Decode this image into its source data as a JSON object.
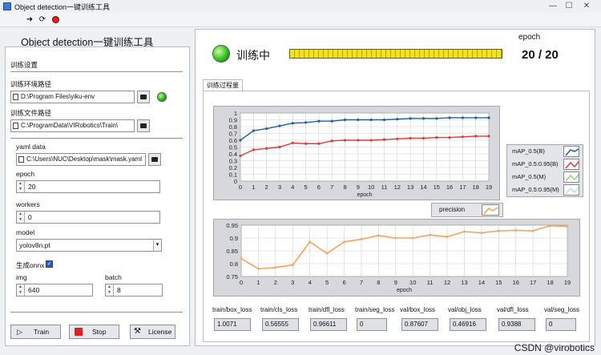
{
  "window": {
    "title": "Object detection一键训练工具"
  },
  "left": {
    "app_title": "Object detection一键训练工具",
    "section_title": "训练设置",
    "env_label": "训练环境路径",
    "env_value": "D:\\Program Files\\yiku-env",
    "files_label": "训练文件路径",
    "files_value": "C:\\ProgramData\\VIRobotics\\Train\\",
    "yaml_label": "yaml data",
    "yaml_value": "C:\\Users\\NUC\\Desktop\\mask\\mask.yaml",
    "epoch_label": "epoch",
    "epoch_value": "20",
    "workers_label": "workers",
    "workers_value": "0",
    "model_label": "model",
    "model_value": "yolov8n.pt",
    "onnx_label": "生成onnx",
    "img_label": "img",
    "img_value": "640",
    "batch_label": "batch",
    "batch_value": "8",
    "train_button": "Train",
    "stop_button": "Stop",
    "license_button": "License"
  },
  "right": {
    "status_text": "训练中",
    "progress": 1.0,
    "epoch_label": "epoch",
    "epoch_value": "20 / 20",
    "tab_label": "训练过程量",
    "precision_legend": "precision"
  },
  "chart_data": [
    {
      "type": "line",
      "xlabel": "epoch",
      "x": [
        0,
        1,
        2,
        3,
        4,
        5,
        6,
        7,
        8,
        9,
        10,
        11,
        12,
        13,
        14,
        15,
        16,
        17,
        18,
        19
      ],
      "ylim": [
        0,
        1
      ],
      "yticks": [
        "0",
        "0.1",
        "0.2",
        "0.3",
        "0.4",
        "0.5",
        "0.6",
        "0.7",
        "0.8",
        "0.9",
        "1"
      ],
      "series": [
        {
          "name": "mAP_0.5(B)",
          "color": "#1f5fa8",
          "values": [
            0.6,
            0.74,
            0.77,
            0.81,
            0.85,
            0.86,
            0.88,
            0.88,
            0.9,
            0.9,
            0.9,
            0.9,
            0.91,
            0.92,
            0.92,
            0.92,
            0.93,
            0.93,
            0.93,
            0.93
          ]
        },
        {
          "name": "mAP_0.5:0.95(B)",
          "color": "#e03a3a",
          "values": [
            0.37,
            0.46,
            0.48,
            0.5,
            0.56,
            0.55,
            0.55,
            0.59,
            0.6,
            0.6,
            0.6,
            0.61,
            0.62,
            0.63,
            0.63,
            0.64,
            0.64,
            0.65,
            0.66,
            0.66
          ]
        },
        {
          "name": "mAP_0.5(M)",
          "color": "#6ad64a",
          "values": []
        },
        {
          "name": "mAP_0.5:0.95(M)",
          "color": "#9fd8f0",
          "values": []
        }
      ],
      "grid": true
    },
    {
      "type": "line",
      "xlabel": "epoch",
      "x": [
        0,
        1,
        2,
        3,
        4,
        5,
        6,
        7,
        8,
        9,
        10,
        11,
        12,
        13,
        14,
        15,
        16,
        17,
        18,
        19
      ],
      "ylim": [
        0.75,
        0.95
      ],
      "yticks": [
        "0.75",
        "0.8",
        "0.85",
        "0.9",
        "0.95"
      ],
      "series": [
        {
          "name": "precision",
          "color": "#f4a460",
          "values": [
            0.82,
            0.78,
            0.785,
            0.795,
            0.885,
            0.84,
            0.885,
            0.895,
            0.91,
            0.9,
            0.9,
            0.912,
            0.905,
            0.925,
            0.92,
            0.928,
            0.93,
            0.928,
            0.948,
            0.945
          ]
        }
      ],
      "grid": true
    }
  ],
  "losses": [
    {
      "label": "train/box_loss",
      "value": "1.0071"
    },
    {
      "label": "train/cls_loss",
      "value": "0.56555"
    },
    {
      "label": "train/dfl_loss",
      "value": "0.96611"
    },
    {
      "label": "train/seg_loss",
      "value": "0"
    },
    {
      "label": "val/box_loss",
      "value": "0.87607"
    },
    {
      "label": "val/obj_loss",
      "value": "0.46916"
    },
    {
      "label": "val/dfl_loss",
      "value": "0.9388"
    },
    {
      "label": "val/seg_loss",
      "value": "0"
    }
  ],
  "watermark": "CSDN @virobotics"
}
